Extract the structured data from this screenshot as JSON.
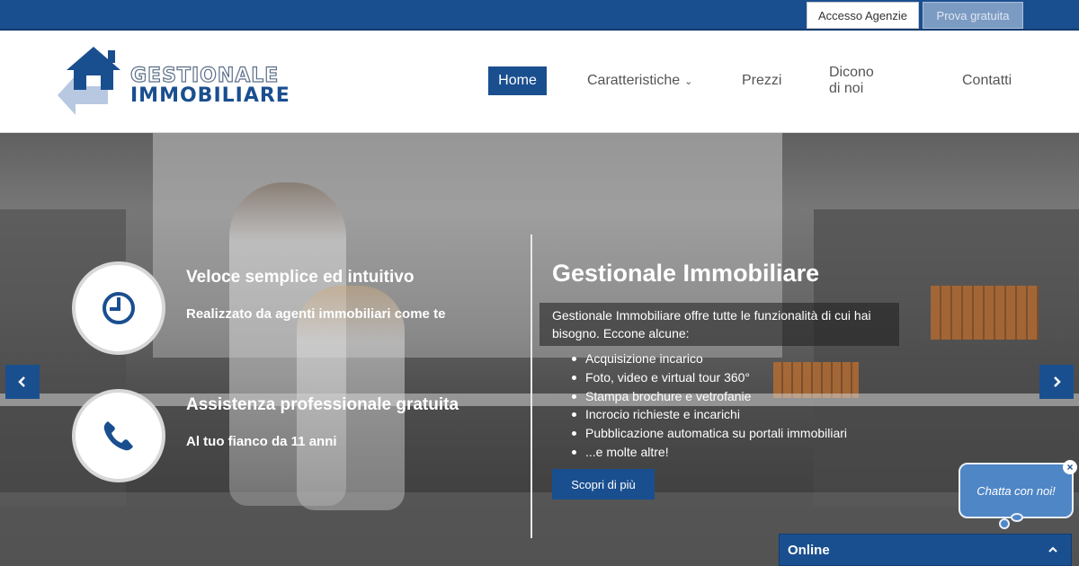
{
  "topbar": {
    "access_label": "Accesso Agenzie",
    "trial_label": "Prova gratuita"
  },
  "logo": {
    "line1": "GESTIONALE",
    "line2": "IMMOBILIARE"
  },
  "nav": {
    "items": [
      {
        "label": "Home",
        "active": true
      },
      {
        "label": "Caratteristiche",
        "has_dropdown": true
      },
      {
        "label": "Prezzi"
      },
      {
        "label": "Dicono di noi"
      },
      {
        "label": "Contatti"
      }
    ]
  },
  "hero": {
    "features": [
      {
        "icon": "clock-icon",
        "title": "Veloce semplice ed intuitivo",
        "subtitle": "Realizzato da agenti immobiliari come te"
      },
      {
        "icon": "phone-icon",
        "title": "Assistenza professionale gratuita",
        "subtitle": "Al tuo fianco da 11 anni"
      }
    ],
    "title": "Gestionale Immobiliare",
    "description": "Gestionale Immobiliare offre tutte le funzionalità di cui hai bisogno. Eccone alcune:",
    "list": [
      "Acquisizione incarico",
      "Foto, video e virtual tour 360°",
      "Stampa brochure e vetrofanie",
      "Incrocio richieste e incarichi",
      "Pubblicazione automatica su portali immobiliari",
      "...e molte altre!"
    ],
    "cta_label": "Scopri di più"
  },
  "chat": {
    "bubble": "Chatta con noi!",
    "status": "Online"
  },
  "colors": {
    "brand": "#1a4f8f",
    "chat_bubble": "#4f86c6"
  }
}
